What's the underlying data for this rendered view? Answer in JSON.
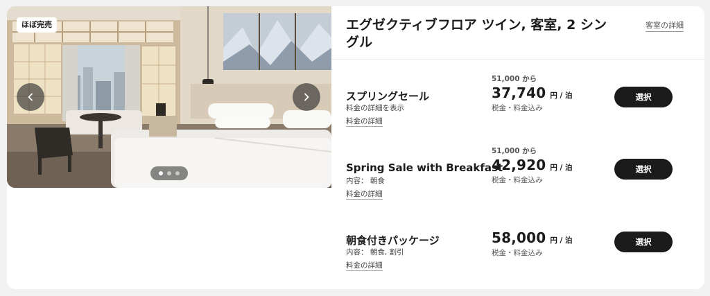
{
  "gallery": {
    "badge": "ほぼ完売",
    "slide_count": 3,
    "active_slide": 1
  },
  "room": {
    "title": "エグゼクティブフロア ツイン, 客室, 2 シングル",
    "details_link": "客室の詳細"
  },
  "rates": [
    {
      "name": "スプリングセール",
      "sub": "料金の詳細を表示",
      "link": "料金の詳細",
      "from": "51,000 から",
      "price": "37,740",
      "unit": "円 / 泊",
      "tax": "税金・料金込み",
      "button": "選択"
    },
    {
      "name": "Spring Sale with Breakfast",
      "sub": "内容： 朝食",
      "link": "料金の詳細",
      "from": "51,000 から",
      "price": "42,920",
      "unit": "円 / 泊",
      "tax": "税金・料金込み",
      "button": "選択"
    },
    {
      "name": "朝食付きパッケージ",
      "sub": "内容： 朝食, 割引",
      "link": "料金の詳細",
      "from": "",
      "price": "58,000",
      "unit": "円 / 泊",
      "tax": "税金・料金込み",
      "button": "選択"
    }
  ],
  "icons": {
    "prev": "chevron-left-icon",
    "next": "chevron-right-icon"
  }
}
